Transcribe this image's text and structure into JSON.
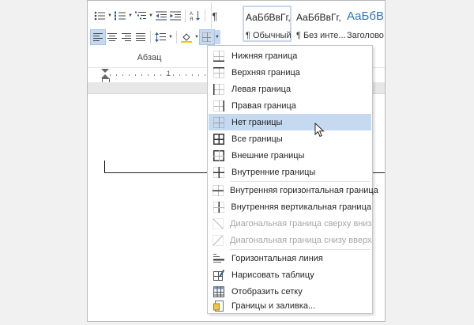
{
  "ribbon": {
    "group_label": "Абзац",
    "styles": [
      {
        "sample": "АаБбВвГг,",
        "name": "¶ Обычный"
      },
      {
        "sample": "АаБбВвГг,",
        "name": "¶ Без инте..."
      },
      {
        "sample": "АаБбВ",
        "name": "Заголово"
      }
    ],
    "accent_color": "#2b579a",
    "active_highlight": "#c5d9f1"
  },
  "ruler": {
    "number": "1"
  },
  "menu": {
    "items": [
      {
        "label": "Нижняя граница",
        "icon": "border-bottom-icon"
      },
      {
        "label": "Верхняя граница",
        "icon": "border-top-icon"
      },
      {
        "label": "Левая граница",
        "icon": "border-left-icon"
      },
      {
        "label": "Правая граница",
        "icon": "border-right-icon"
      },
      {
        "label": "Нет границы",
        "icon": "border-none-icon",
        "state": "hover"
      },
      {
        "label": "Все границы",
        "icon": "border-all-icon"
      },
      {
        "label": "Внешние границы",
        "icon": "border-outside-icon"
      },
      {
        "label": "Внутренние границы",
        "icon": "border-inside-icon"
      },
      {
        "label": "Внутренняя горизонтальная граница",
        "icon": "border-inside-horizontal-icon"
      },
      {
        "label": "Внутренняя вертикальная граница",
        "icon": "border-inside-vertical-icon"
      },
      {
        "label": "Диагональная граница сверху вниз",
        "icon": "diagonal-down-border-icon",
        "state": "disabled"
      },
      {
        "label": "Диагональная граница снизу вверх",
        "icon": "diagonal-up-border-icon",
        "state": "disabled"
      },
      {
        "label": "Горизонтальная линия",
        "icon": "horizontal-line-icon"
      },
      {
        "label": "Нарисовать таблицу",
        "icon": "draw-table-icon"
      },
      {
        "label": "Отобразить сетку",
        "icon": "view-gridlines-icon"
      },
      {
        "label": "Границы и заливка...",
        "icon": "borders-shading-icon"
      }
    ]
  }
}
